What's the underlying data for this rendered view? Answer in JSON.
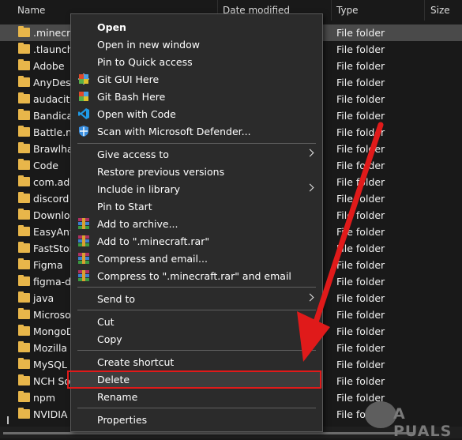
{
  "header": {
    "col_name": "Name",
    "col_date": "Date modified",
    "col_type": "Type",
    "col_size": "Size"
  },
  "files": [
    {
      "name": ".minecra",
      "type": "File folder",
      "selected": true
    },
    {
      "name": ".tlaunche",
      "type": "File folder"
    },
    {
      "name": "Adobe",
      "type": "File folder"
    },
    {
      "name": "AnyDesk",
      "type": "File folder"
    },
    {
      "name": "audacity",
      "type": "File folder"
    },
    {
      "name": "Bandicar",
      "type": "File folder"
    },
    {
      "name": "Battle.ne",
      "type": "File folder"
    },
    {
      "name": "Brawlhal",
      "type": "File folder"
    },
    {
      "name": "Code",
      "type": "File folder"
    },
    {
      "name": "com.ado",
      "type": "File folder"
    },
    {
      "name": "discord",
      "type": "File folder"
    },
    {
      "name": "Downlo",
      "type": "File folder"
    },
    {
      "name": "EasyAnti",
      "type": "File folder"
    },
    {
      "name": "FastSton",
      "type": "File folder"
    },
    {
      "name": "Figma",
      "type": "File folder"
    },
    {
      "name": "figma-de",
      "type": "File folder"
    },
    {
      "name": "java",
      "type": "File folder"
    },
    {
      "name": "Microsof",
      "type": "File folder"
    },
    {
      "name": "MongoD",
      "type": "File folder"
    },
    {
      "name": "Mozilla",
      "type": "File folder"
    },
    {
      "name": "MySQL",
      "type": "File folder"
    },
    {
      "name": "NCH Sof",
      "type": "File folder"
    },
    {
      "name": "npm",
      "type": "File folder"
    },
    {
      "name": "NVIDIA",
      "type": "File folder"
    }
  ],
  "menu": {
    "open": "Open",
    "open_new_window": "Open in new window",
    "pin_quick_access": "Pin to Quick access",
    "git_gui": "Git GUI Here",
    "git_bash": "Git Bash Here",
    "open_code": "Open with Code",
    "scan_defender": "Scan with Microsoft Defender...",
    "give_access": "Give access to",
    "restore_versions": "Restore previous versions",
    "include_library": "Include in library",
    "pin_start": "Pin to Start",
    "add_archive": "Add to archive...",
    "add_rar": "Add to \".minecraft.rar\"",
    "compress_email": "Compress and email...",
    "compress_rar_email": "Compress to \".minecraft.rar\" and email",
    "send_to": "Send to",
    "cut": "Cut",
    "copy": "Copy",
    "create_shortcut": "Create shortcut",
    "delete": "Delete",
    "rename": "Rename",
    "properties": "Properties"
  },
  "watermark": "A PUALS",
  "colors": {
    "folder": "#e8b64a",
    "highlight": "#e01a1a",
    "menu_bg": "#2b2b2b"
  }
}
